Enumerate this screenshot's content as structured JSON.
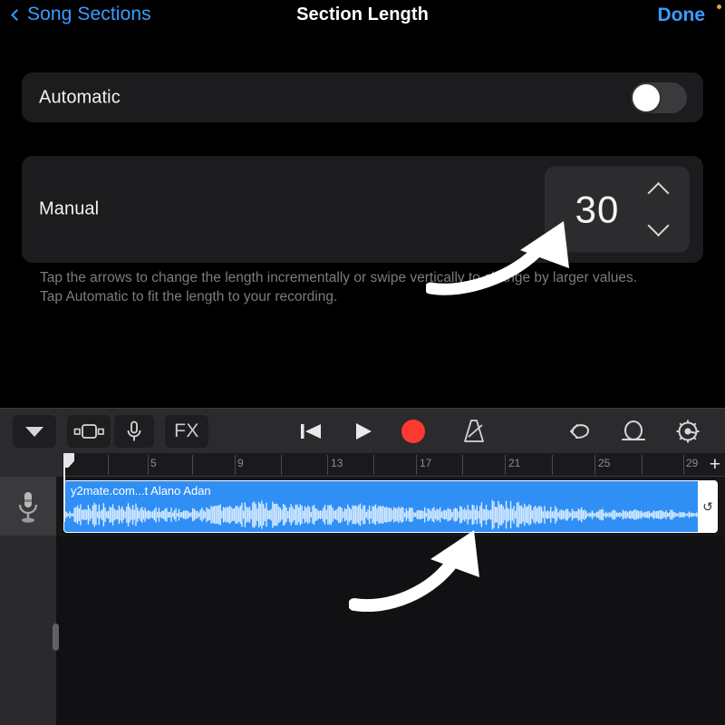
{
  "navbar": {
    "back_label": "Song Sections",
    "back_icon": "chevron-left-icon",
    "title": "Section Length",
    "done_label": "Done",
    "notification_dot_color": "#e8a33d"
  },
  "settings": {
    "automatic": {
      "label": "Automatic",
      "toggle_state": "off"
    },
    "manual": {
      "label": "Manual",
      "value": "30",
      "increment_icon": "chevron-up-icon",
      "decrement_icon": "chevron-down-icon"
    },
    "hint_line_1": "Tap the arrows to change the length incrementally or swipe vertically to change by larger values.",
    "hint_line_2": "Tap Automatic to fit the length to your recording."
  },
  "annotations": [
    {
      "name": "arrow-to-stepper",
      "icon": "curved-arrow-up-right-icon"
    },
    {
      "name": "arrow-to-region",
      "icon": "curved-arrow-up-right-icon"
    }
  ],
  "toolbar": {
    "buttons": [
      {
        "name": "navigation-menu-button",
        "icon": "triangle-down-icon",
        "label": ""
      },
      {
        "name": "tracks-view-button",
        "icon": "tracks-view-icon",
        "label": ""
      },
      {
        "name": "instrument-button",
        "icon": "microphone-icon",
        "label": ""
      },
      {
        "name": "fx-button",
        "icon": "fx-icon",
        "label": "FX"
      },
      {
        "name": "rewind-button",
        "icon": "rewind-to-start-icon",
        "label": ""
      },
      {
        "name": "play-button",
        "icon": "play-icon",
        "label": ""
      },
      {
        "name": "record-button",
        "icon": "record-icon",
        "label": ""
      },
      {
        "name": "metronome-button",
        "icon": "metronome-icon",
        "label": ""
      },
      {
        "name": "undo-button",
        "icon": "undo-arrow-icon",
        "label": ""
      },
      {
        "name": "loop-browser-button",
        "icon": "loop-icon",
        "label": ""
      },
      {
        "name": "settings-button",
        "icon": "gear-icon",
        "label": ""
      }
    ],
    "record_color": "#fc3a32"
  },
  "ruler": {
    "tick_labels": [
      "5",
      "9",
      "13",
      "17",
      "21",
      "25",
      "29"
    ],
    "add_track_label": "+"
  },
  "track": {
    "icon": "microphone-icon",
    "region_title": "y2mate.com...t Alano Adan",
    "region_color": "#2f8ff5",
    "loop_handle_icon": "loop-region-icon"
  }
}
